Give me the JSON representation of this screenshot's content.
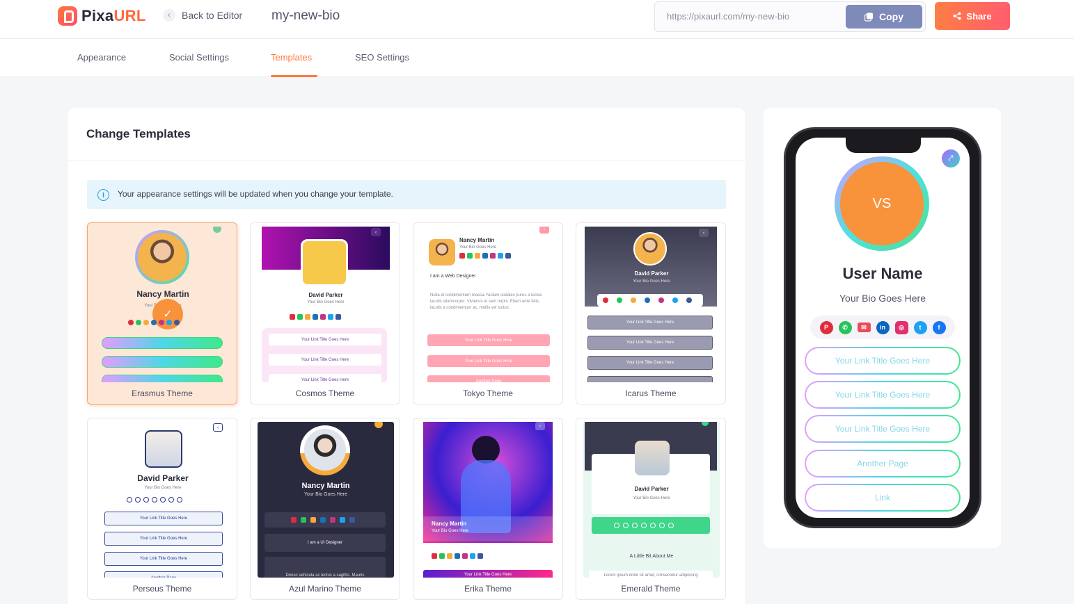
{
  "header": {
    "logo_part1": "Pixa",
    "logo_part2": "URL",
    "back_label": "Back to Editor",
    "page_slug": "my-new-bio",
    "url": "https://pixaurl.com/my-new-bio",
    "copy_label": "Copy",
    "share_label": "Share"
  },
  "tabs": [
    {
      "label": "Appearance"
    },
    {
      "label": "Social Settings"
    },
    {
      "label": "Templates",
      "active": true
    },
    {
      "label": "SEO Settings"
    }
  ],
  "main": {
    "title": "Change Templates",
    "info": "Your appearance settings will be updated when you change your template."
  },
  "templates": [
    {
      "name": "Erasmus Theme",
      "selected": true,
      "person": "Nancy Martin",
      "bio": "Your Bio Goes Here"
    },
    {
      "name": "Cosmos Theme",
      "person": "David Parker",
      "bio": "Your Bio Goes Here",
      "link": "Your Link Title Goes Here"
    },
    {
      "name": "Tokyo Theme",
      "person": "Nancy Martin",
      "bio": "Your Bio Goes Here",
      "tagline": "I am a Web Designer",
      "about": "Nulla et condimentum massa. Nullam sodales purus a luctus iaculis ullamcorper. Vivamus et sem turpis. Etiam ante felis, iaculis a condimentum ac, mollis vel luctus.",
      "link": "Your Link Title Goes Here",
      "other": "Another Page"
    },
    {
      "name": "Icarus Theme",
      "person": "David Parker",
      "bio": "Your Bio Goes Here",
      "link": "Your Link Title Goes Here"
    },
    {
      "name": "Perseus Theme",
      "person": "David Parker",
      "bio": "Your Bio Goes Here",
      "link": "Your Link Title Goes Here",
      "other": "Another Page"
    },
    {
      "name": "Azul Marino Theme",
      "person": "Nancy Martin",
      "bio": "Your Bio Goes Here",
      "tagline": "I am a UI Designer",
      "about": "Donec vehicula ac lectus a sagittis. Mauris"
    },
    {
      "name": "Erika Theme",
      "person": "Nancy Martin",
      "bio": "Your Bio Goes Here",
      "link": "Your Link Title Goes Here"
    },
    {
      "name": "Emerald Theme",
      "person": "David Parker",
      "bio": "Your Bio Goes Here",
      "about_title": "A Little Bit About Me",
      "about": "Lorem ipsum dolor sit amet, consectetur adipiscing"
    }
  ],
  "preview": {
    "initials": "VS",
    "name": "User Name",
    "bio": "Your Bio Goes Here",
    "social_icons": [
      "pinterest-icon",
      "whatsapp-icon",
      "email-icon",
      "linkedin-icon",
      "instagram-icon",
      "twitter-icon",
      "facebook-icon"
    ],
    "links": [
      "Your Link Title Goes Here",
      "Your Link Title Goes Here",
      "Your Link Title Goes Here",
      "Another Page",
      "Link"
    ]
  },
  "colors": {
    "accent": "#ff7a3c",
    "copy_button": "#7e8ab8",
    "info_bg": "#e6f5fb",
    "preview_avatar": "#f8923b"
  }
}
